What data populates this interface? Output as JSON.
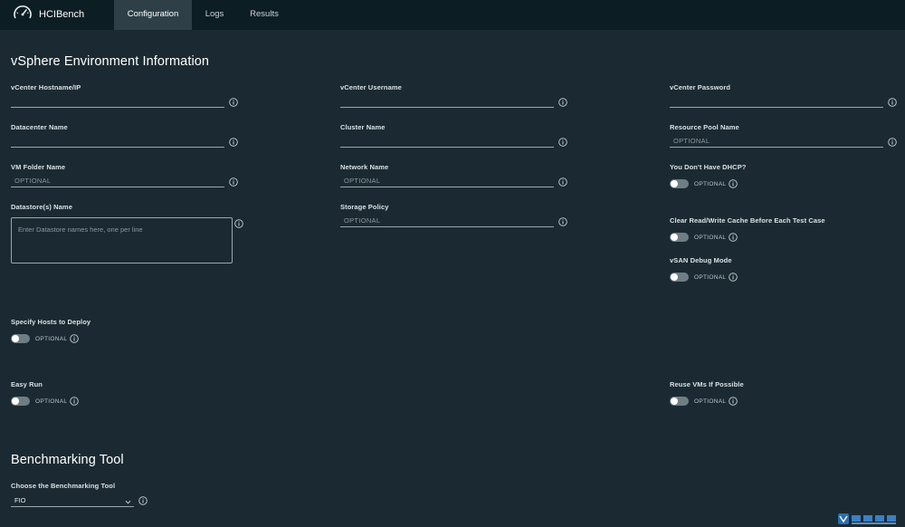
{
  "app": {
    "name": "HCIBench",
    "tabs": [
      "Configuration",
      "Logs",
      "Results"
    ],
    "active_tab": "Configuration"
  },
  "vsphere": {
    "title": "vSphere Environment Information",
    "vcenter_hostname": {
      "label": "vCenter Hostname/IP",
      "value": "",
      "placeholder": ""
    },
    "vcenter_username": {
      "label": "vCenter Username",
      "value": "",
      "placeholder": ""
    },
    "vcenter_password": {
      "label": "vCenter Password",
      "value": "",
      "placeholder": ""
    },
    "datacenter_name": {
      "label": "Datacenter Name",
      "value": "",
      "placeholder": ""
    },
    "cluster_name": {
      "label": "Cluster Name",
      "value": "",
      "placeholder": ""
    },
    "resource_pool_name": {
      "label": "Resource Pool Name",
      "value": "",
      "placeholder": "OPTIONAL"
    },
    "vm_folder_name": {
      "label": "VM Folder Name",
      "value": "",
      "placeholder": "OPTIONAL"
    },
    "network_name": {
      "label": "Network Name",
      "value": "",
      "placeholder": "OPTIONAL"
    },
    "no_dhcp": {
      "label": "You Don't Have DHCP?",
      "toggle_text": "OPTIONAL",
      "on": false
    },
    "datastores": {
      "label": "Datastore(s) Name",
      "placeholder": "Enter Datastore names here, one per line"
    },
    "storage_policy": {
      "label": "Storage Policy",
      "value": "",
      "placeholder": "OPTIONAL"
    },
    "clear_cache": {
      "label": "Clear Read/Write Cache Before Each Test Case",
      "toggle_text": "OPTIONAL",
      "on": false
    },
    "vsan_debug": {
      "label": "vSAN Debug Mode",
      "toggle_text": "OPTIONAL",
      "on": false
    },
    "specify_hosts": {
      "label": "Specify Hosts to Deploy",
      "toggle_text": "OPTIONAL",
      "on": false
    },
    "easy_run": {
      "label": "Easy Run",
      "toggle_text": "OPTIONAL",
      "on": false
    },
    "reuse_vms": {
      "label": "Reuse VMs If Possible",
      "toggle_text": "OPTIONAL",
      "on": false
    }
  },
  "benchmarking": {
    "title": "Benchmarking Tool",
    "tool": {
      "label": "Choose the Benchmarking Tool",
      "selected": "FIO"
    }
  },
  "icons": {
    "logo": "speedometer-icon",
    "info": "info-icon",
    "chevron": "chevron-down-icon"
  },
  "colors": {
    "background": "#1b2a32",
    "header": "#0d1d24",
    "active_tab": "#2e3f47",
    "toggle_off": "#6f7d84"
  }
}
